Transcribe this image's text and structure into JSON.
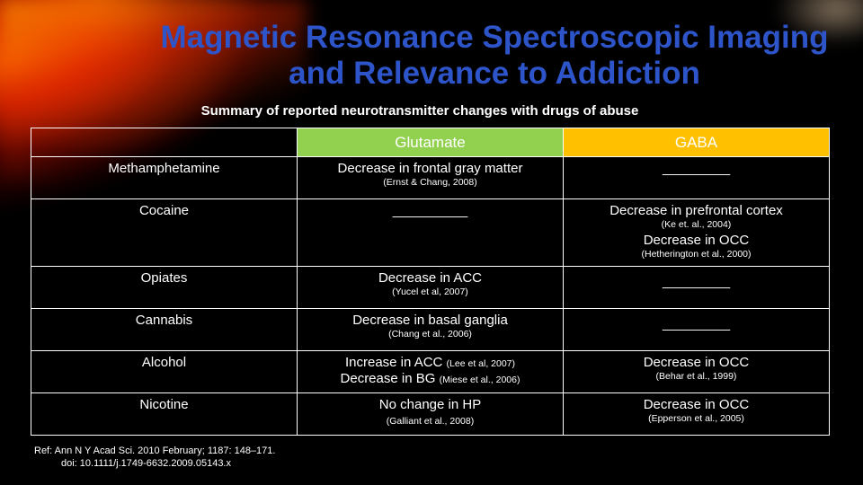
{
  "title": "Magnetic Resonance Spectroscopic Imaging and Relevance to Addiction",
  "subtitle": "Summary of reported neurotransmitter changes with drugs of abuse",
  "columns": [
    "",
    "Glutamate",
    "GABA"
  ],
  "colors": {
    "title": "#2e54c9",
    "glutamate_header": "#92d050",
    "gaba_header": "#ffc000",
    "background": "#000000"
  },
  "rows": [
    {
      "drug": "Methamphetamine",
      "glutamate": {
        "text": "Decrease in frontal gray matter",
        "cite": "(Ernst & Chang, 2008)"
      },
      "gaba": {
        "blank": "_________"
      }
    },
    {
      "drug": "Cocaine",
      "glutamate": {
        "blank": "__________"
      },
      "gaba": {
        "text": "Decrease in prefrontal cortex",
        "cite": "(Ke et. al., 2004)",
        "text2": "Decrease in OCC",
        "cite2": "(Hetherington et al., 2000)"
      }
    },
    {
      "drug": "Opiates",
      "glutamate": {
        "text": "Decrease in ACC",
        "cite": "(Yucel et al, 2007)"
      },
      "gaba": {
        "blank": "_________"
      }
    },
    {
      "drug": "Cannabis",
      "glutamate": {
        "text": "Decrease in basal ganglia",
        "cite": "(Chang et al., 2006)"
      },
      "gaba": {
        "blank": "_________"
      }
    },
    {
      "drug": "Alcohol",
      "glutamate": {
        "line1": "Increase in ACC",
        "line1_cite": "(Lee et al, 2007)",
        "line2": "Decrease in BG",
        "line2_cite": "(Miese et al., 2006)"
      },
      "gaba": {
        "text": "Decrease in OCC",
        "cite": "(Behar et al., 1999)"
      }
    },
    {
      "drug": "Nicotine",
      "glutamate": {
        "text": "No change in HP",
        "cite": "(Galliant et al., 2008)"
      },
      "gaba": {
        "text": "Decrease in OCC",
        "cite": "(Epperson et al., 2005)"
      }
    }
  ],
  "reference": {
    "line1": "Ref: Ann N Y Acad Sci. 2010 February; 1187: 148–171.",
    "line2": "doi:  10.1111/j.1749-6632.2009.05143.x"
  }
}
